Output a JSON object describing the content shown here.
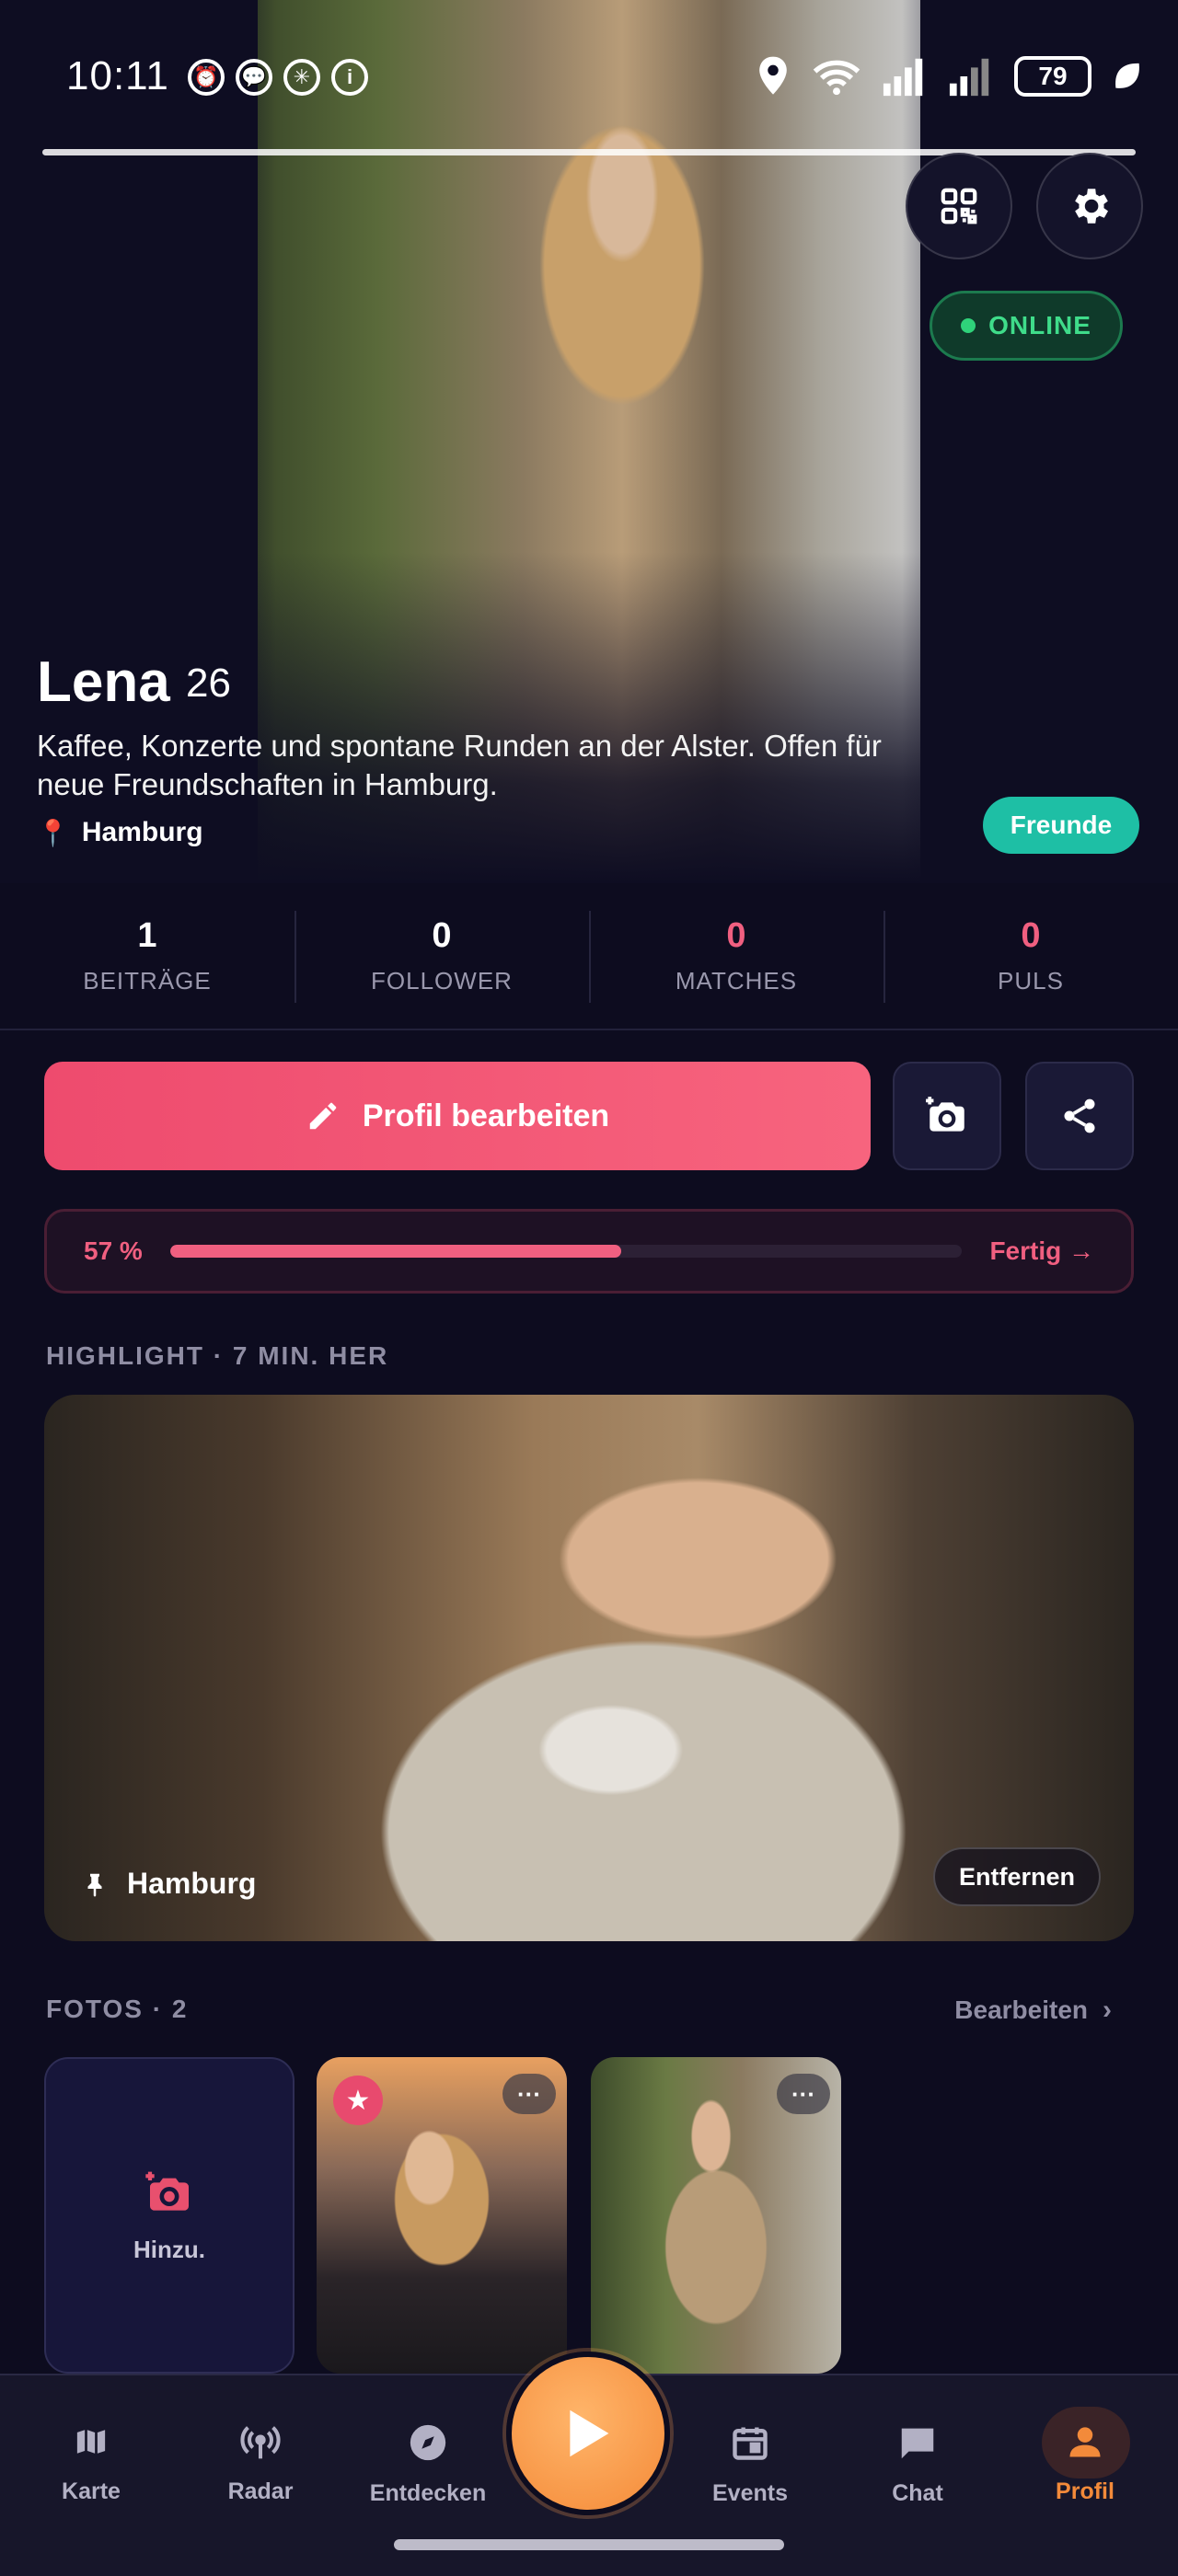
{
  "status_bar": {
    "time": "10:11",
    "battery": "79"
  },
  "profile": {
    "name": "Lena",
    "age": "26",
    "bio": "Kaffee, Konzerte und spontane Runden an der Alster. Offen für neue Freundschaften in Hamburg.",
    "location": "Hamburg",
    "online_label": "ONLINE",
    "relation_badge": "Freunde"
  },
  "stats": [
    {
      "value": "1",
      "label": "BEITRÄGE",
      "color": "#ffffff"
    },
    {
      "value": "0",
      "label": "FOLLOWER",
      "color": "#ffffff"
    },
    {
      "value": "0",
      "label": "MATCHES",
      "color": "#f05f80"
    },
    {
      "value": "0",
      "label": "PULS",
      "color": "#f05f80"
    }
  ],
  "actions": {
    "edit_label": "Profil bearbeiten",
    "add_photo_icon": "camera-plus-icon",
    "share_icon": "share-icon"
  },
  "completion": {
    "percent_label": "57 %",
    "percent": 57,
    "done_label": "Fertig →"
  },
  "highlight": {
    "title": "HIGHLIGHT · 7 MIN. HER",
    "location": "Hamburg",
    "remove_label": "Entfernen"
  },
  "photos": {
    "title": "FOTOS · 2",
    "edit_label": "Bearbeiten",
    "add_label": "Hinzu."
  },
  "nav": [
    {
      "label": "Karte",
      "icon": "map-icon"
    },
    {
      "label": "Radar",
      "icon": "radar-icon"
    },
    {
      "label": "Entdecken",
      "icon": "compass-icon"
    },
    {
      "label": "Events",
      "icon": "calendar-icon"
    },
    {
      "label": "Chat",
      "icon": "chat-icon"
    },
    {
      "label": "Profil",
      "icon": "person-icon",
      "active": true
    }
  ],
  "colors": {
    "accent": "#f05f80",
    "online": "#3fdc8a",
    "friends": "#1ebfa5",
    "play": "#f48a38",
    "active_nav": "#f38a3a"
  }
}
